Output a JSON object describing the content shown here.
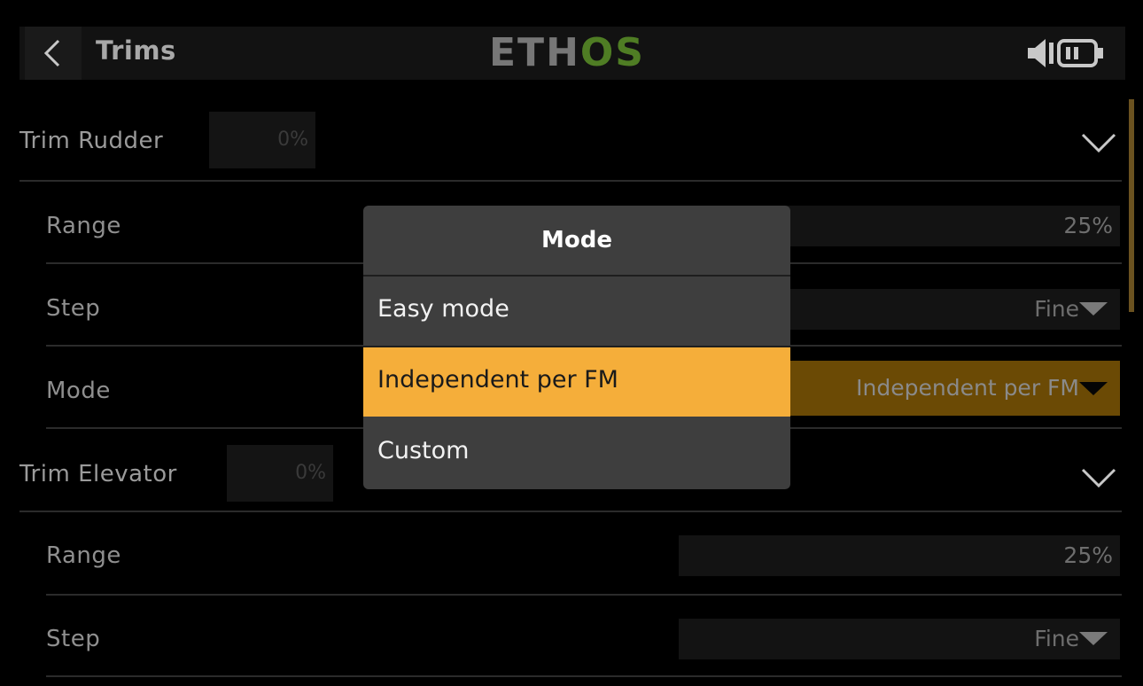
{
  "header": {
    "title": "Trims",
    "logo_left": "ETH",
    "logo_right": "OS",
    "logo_colors": {
      "left": "#777777",
      "right": "#4f7d24"
    },
    "icons": [
      "back-arrow-icon",
      "speaker-icon",
      "battery-icon"
    ]
  },
  "groups": [
    {
      "label": "Trim Rudder",
      "value": "0%",
      "rows": [
        {
          "label": "Range",
          "value": "25%"
        },
        {
          "label": "Step",
          "value": "Fine"
        },
        {
          "label": "Mode",
          "value": "Independent per FM"
        }
      ]
    },
    {
      "label": "Trim Elevator",
      "value": "0%",
      "rows": [
        {
          "label": "Range",
          "value": "25%"
        },
        {
          "label": "Step",
          "value": "Fine"
        }
      ]
    }
  ],
  "dialog": {
    "title": "Mode",
    "options": [
      "Easy mode",
      "Independent per FM",
      "Custom"
    ],
    "selected": "Independent per FM"
  },
  "colors": {
    "accent": "#f5ae3a",
    "active_field": "#6b4a05"
  }
}
